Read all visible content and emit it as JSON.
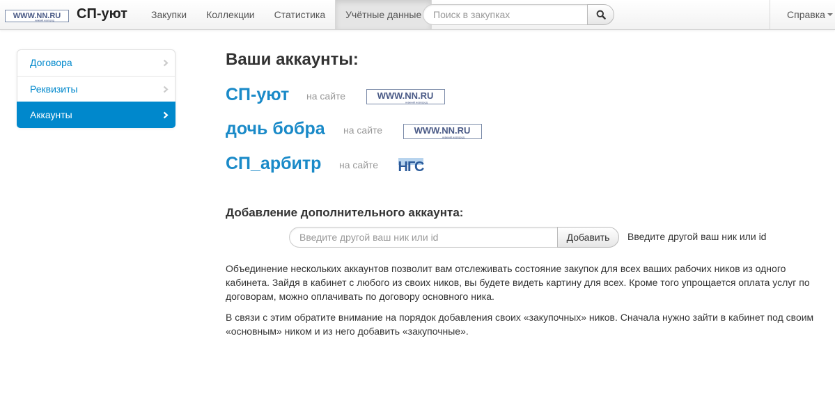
{
  "colors": {
    "accent": "#0088cc",
    "account_link": "#1a8ac8",
    "muted": "#999999"
  },
  "brand": {
    "logo_text": "WWW.NN.RU",
    "logo_sub": "нижний новгород",
    "name": "СП-уют"
  },
  "nav": {
    "items": [
      {
        "label": "Закупки",
        "active": false
      },
      {
        "label": "Коллекции",
        "active": false
      },
      {
        "label": "Статистика",
        "active": false
      },
      {
        "label": "Учётные данные",
        "active": true
      }
    ],
    "search": {
      "placeholder": "Поиск в закупках",
      "value": "",
      "button_icon": "search-icon"
    },
    "help": {
      "label": "Справка",
      "icon": "caret-down-icon"
    }
  },
  "sidebar": {
    "items": [
      {
        "label": "Договора",
        "active": false,
        "icon": "chevron-right-icon"
      },
      {
        "label": "Реквизиты",
        "active": false,
        "icon": "chevron-right-icon"
      },
      {
        "label": "Аккаунты",
        "active": true,
        "icon": "chevron-right-icon"
      }
    ]
  },
  "main": {
    "title": "Ваши аккаунты:",
    "accounts": [
      {
        "name": "СП-уют",
        "site_label": "на сайте",
        "site_logo": "WWW.NN.RU",
        "site_logo_sub": "нижний новгород"
      },
      {
        "name": "дочь бобра",
        "site_label": "на сайте",
        "site_logo": "WWW.NN.RU",
        "site_logo_sub": "нижний новгород"
      },
      {
        "name": "СП_арбитр",
        "site_label": "на сайте",
        "site_logo": "НГС"
      }
    ],
    "add": {
      "title": "Добавление дополнительного аккаунта:",
      "placeholder": "Введите другой ваш ник или id",
      "value": "",
      "button": "Добавить",
      "hint": "Введите другой ваш ник или id"
    },
    "paragraphs": [
      "Объединение нескольких аккаунтов позволит вам отслеживать состояние закупок для всех ваших рабочих ников из одного кабинета. Зайдя в кабинет с любого из своих ников, вы будете видеть картину для всех. Кроме того упрощается оплата услуг по договорам, можно оплачивать по договору основного ника.",
      "В связи с этим обратите внимание на порядок добавления своих «закупочных» ников. Сначала нужно зайти в кабинет под своим «основным» ником и из него добавить «закупочные»."
    ]
  }
}
